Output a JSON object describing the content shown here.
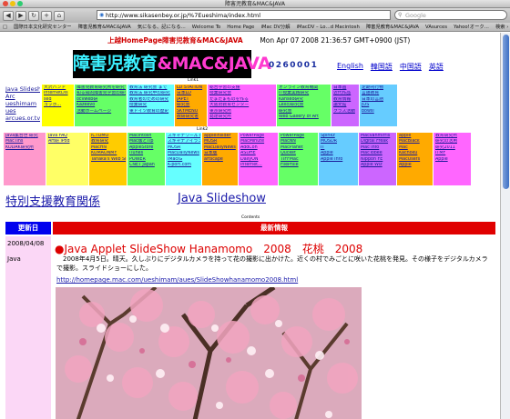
{
  "window": {
    "title": "障害児教育&MAC&JAVA"
  },
  "toolbar": {
    "back": "◀",
    "forward": "▶",
    "reload": "↻",
    "add": "+",
    "home": "⌂"
  },
  "address": {
    "url": "http://www.sikasenbey.or.jp/%7Eueshima/index.html"
  },
  "search": {
    "placeholder": "Google"
  },
  "bookmarks": [
    "□",
    "国際日本文化研究センター",
    "障害児教育&MAC&JAVA",
    "気になる、記になる…",
    "Welcome To",
    "Home Page",
    "iMac DV分解",
    "iMacDV – Lo…d Macintosh",
    "障害児教育&MAC&JAVA",
    "VAsurces",
    "Yahoo!オーク…",
    "検索 ›",
    "»"
  ],
  "header": {
    "tagline": "上越HomePage障害児教育&MAC&JAVA",
    "datetime": "Mon Apr 07 2008 21:36:57 GMT+0900 (JST)",
    "banner": {
      "part1": "障害児教育",
      "part2": "&MAC&JAVA"
    },
    "counter": "0260001",
    "languages": [
      "English",
      "韓国語",
      "中国語",
      "英語"
    ]
  },
  "link_labels": {
    "link1": "Link1",
    "link2": "Link2"
  },
  "link_grid_top": [
    {
      "bg": "#ffffff",
      "items": [
        "Java Slideshow",
        "Arc",
        "ueshimam",
        "ues",
        "arcues.or.tv"
      ]
    },
    {
      "bg": "#ffff00",
      "items": [
        "大沢バンド",
        "InternetDis",
        "sed",
        "",
        "ゴッホ…"
      ]
    },
    {
      "bg": "#66ff66",
      "items": [
        "障害児教育研究所を研究する",
        "知る知的障害児学習の研究",
        "ocvweb研",
        "Kazeevo",
        "",
        "活動ホームページ"
      ]
    },
    {
      "bg": "#66ffff",
      "items": [
        "教育法 研究会 まで",
        "教育法 研究中の研究",
        "教育者のための研究",
        "授業研究",
        "東ドイツ教育の歴史"
      ]
    },
    {
      "bg": "#ffaa00",
      "items": [
        "LD STATION",
        "日本LD",
        "JAPET",
        "研究会",
        "SKYMENU",
        "教研研究者"
      ]
    },
    {
      "bg": "#ff66ff",
      "items": [
        "総合学習の支援",
        "授業研究会",
        "たまたまものを作る",
        "大阪府教育センター",
        "東京研究所",
        "発達研究所"
      ]
    },
    {
      "bg": "#66ff66",
      "items": [
        "オンライン教育機関",
        "IT授業実践研究",
        "Kanseo研究",
        "Lexの研究会",
        "研究会",
        "Web Gallery of Art"
      ]
    },
    {
      "bg": "#cc66ff",
      "items": [
        "日本画",
        "近代作品",
        "教育情報",
        "論文館",
        "クラス活動"
      ]
    },
    {
      "bg": "#66ccff",
      "items": [
        "定期刊行物",
        "言語教育",
        "日本の言語",
        "JOS",
        "bowsi"
      ]
    }
  ],
  "link_grid_bottom": [
    {
      "bg": "#ff99cc",
      "items": [
        "Java集合世 研究",
        "MacTins",
        "",
        "KODAK研究所",
        ""
      ]
    },
    {
      "bg": "#ffff66",
      "items": [
        "Java FAQ",
        "Art研 iPod",
        "",
        "",
        ""
      ]
    },
    {
      "bg": "#ffcc00",
      "items": [
        "iCTOMO",
        "教育研究",
        "",
        "MacHN",
        "KUMAONMY",
        "Tanaka's Web Site"
      ]
    },
    {
      "bg": "#66ff66",
      "items": [
        "Macintosh",
        "Mac版とTip",
        "AppleStore",
        "iTunes",
        "POWER",
        "CNET Japan"
      ]
    },
    {
      "bg": "#66ffff",
      "items": [
        "スキャナワールド",
        "スキャナアイランド",
        "MOSR",
        "MacDailyNews",
        "iMacIG",
        "K-port.com"
      ]
    },
    {
      "bg": "#ffaa00",
      "items": [
        "appleinsider",
        "MOSR",
        "MacDailyNews",
        "日本版",
        "artscape"
      ]
    },
    {
      "bg": "#ff66ff",
      "items": [
        "PowerPage",
        "MacMinute",
        "AddCon",
        "ASDHE",
        "DailyON",
        "Internet…"
      ]
    },
    {
      "bg": "#66ff66",
      "items": [
        "PowerPage",
        "MacNN",
        "MacPlanet",
        "Qucket",
        "TIFFMac",
        "FilePhile"
      ]
    },
    {
      "bg": "#66ccff",
      "items": [
        "Spinkz",
        "MOSDR",
        "IT",
        "Apple",
        "Apple Info"
      ]
    },
    {
      "bg": "#cc66ff",
      "items": [
        "Macvanmirris",
        "Digital Freak",
        "Mac info",
        "MacTobee",
        "Nippon FE",
        "Apple Wiz"
      ]
    },
    {
      "bg": "#ffaa00",
      "items": [
        "apple",
        "MacBlack",
        "Mac",
        "Kachoku",
        "MacUsers",
        "Apple"
      ]
    },
    {
      "bg": "#ff66ff",
      "items": [
        "教育研究所",
        "研究の活用",
        "研究2011",
        "ITMF",
        "Apple"
      ]
    }
  ],
  "headings": {
    "left": "特別支援教育関係",
    "right": "Java Slideshow"
  },
  "contents_label": "Contents",
  "table": {
    "col_date": "更新日",
    "col_news": "最新情報"
  },
  "post": {
    "date": "2008/04/08",
    "category": "Java",
    "title": "●Java Applet SlideShow Hanamomo　2008　花桃　2008",
    "body": "　2008年4月5日。晴天。久しぶりにデジタルカメラを持って花の撮影に出かけた。近くの村でみごとに咲いた花桃を発見。その様子をデジタルカメラで撮影。スライドショーにした。",
    "link": "http://homepage.mac.com/ueshimam/aues/SlideShowhanamomo2008.html"
  },
  "colors": {
    "banner_part1": "#3cf0ff",
    "banner_part2": "#ff3ad0",
    "header_blue": "#0000ee",
    "header_red": "#e00000",
    "left_col_bg": "#fbd7f6"
  }
}
